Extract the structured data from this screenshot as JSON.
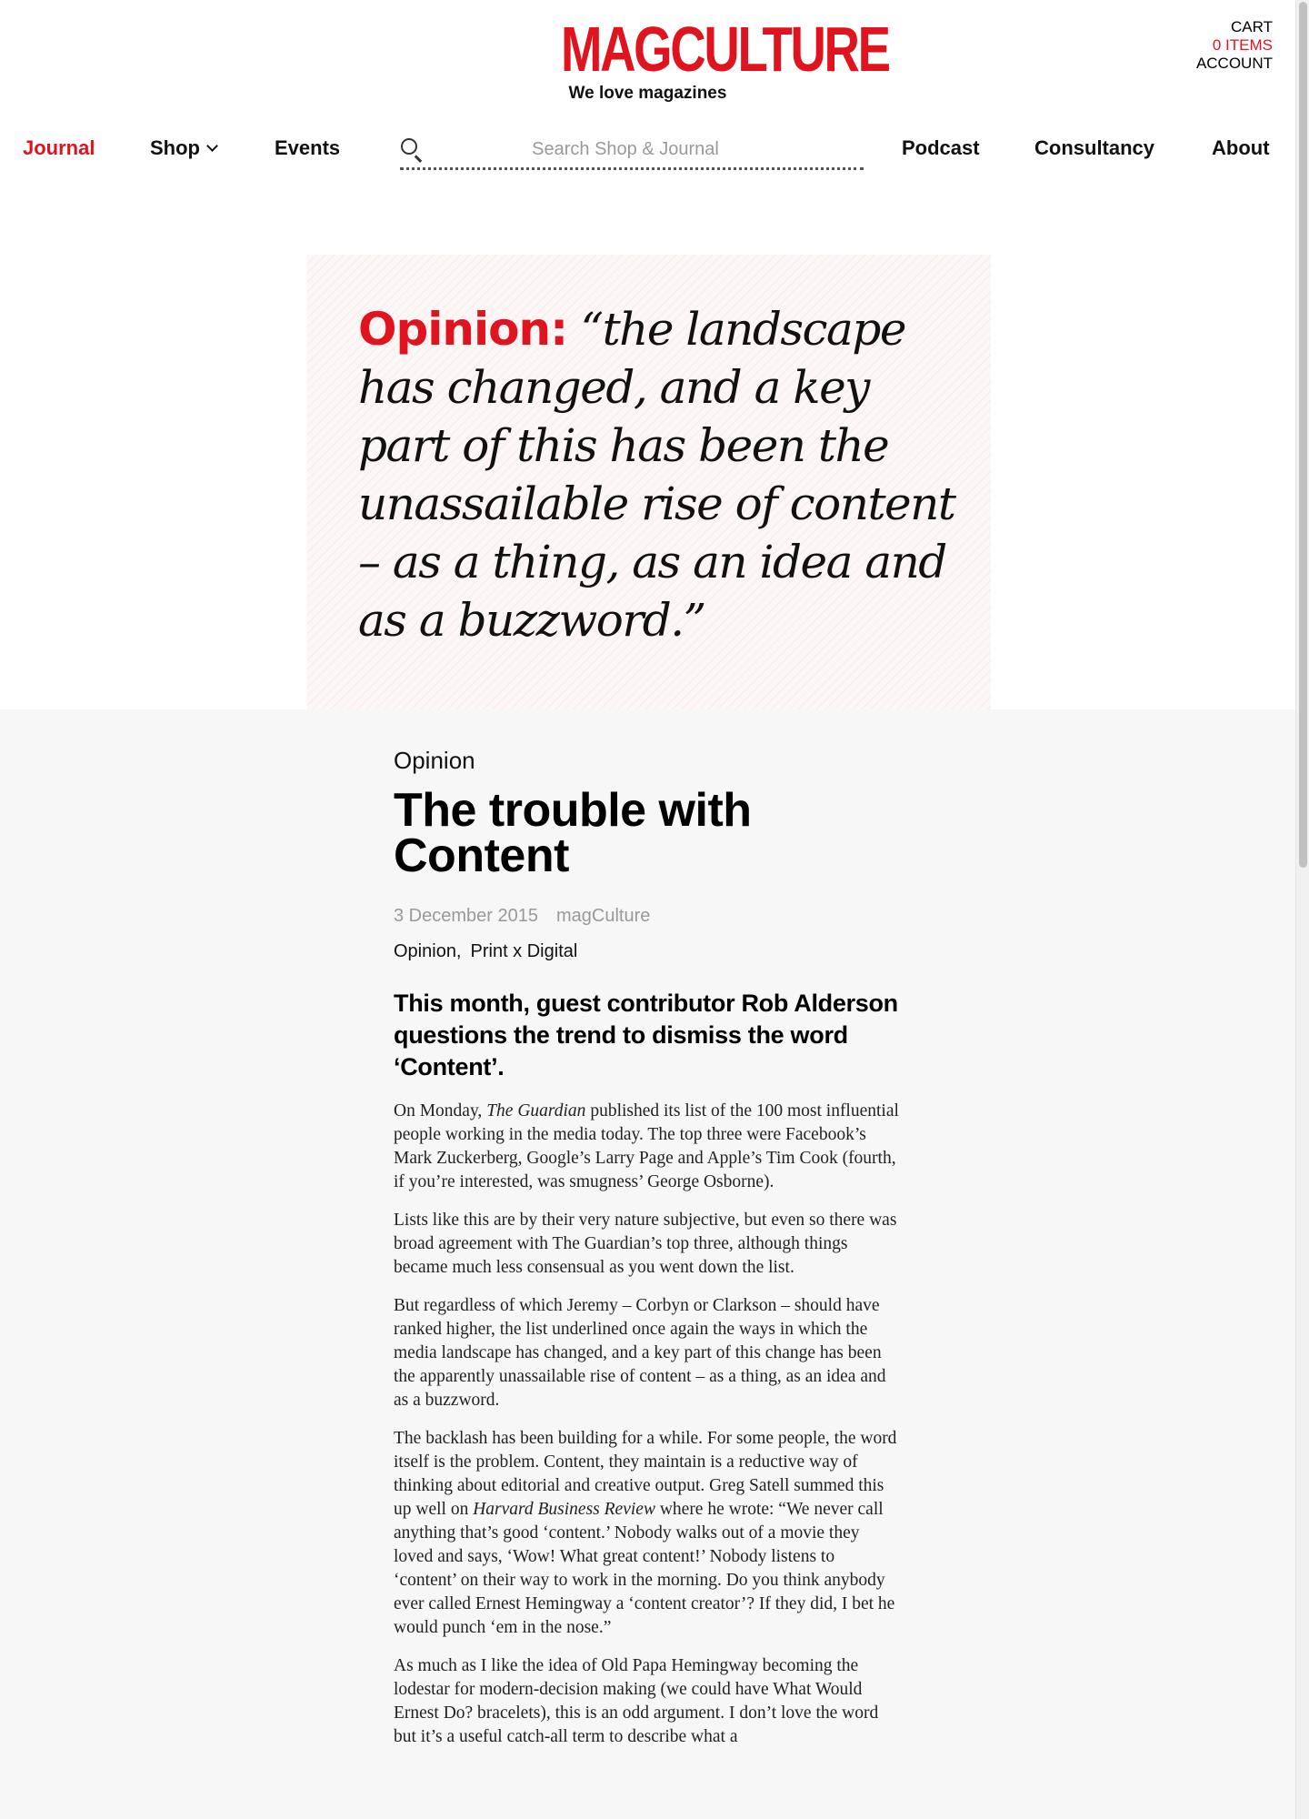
{
  "header": {
    "logo": "MAGCULTURE",
    "tagline": "We love magazines",
    "cart_label": "CART",
    "cart_items": "0 ITEMS",
    "account_label": "ACCOUNT"
  },
  "nav": {
    "journal": "Journal",
    "shop": "Shop",
    "events": "Events",
    "search_placeholder": "Search Shop & Journal",
    "podcast": "Podcast",
    "consultancy": "Consultancy",
    "about": "About"
  },
  "hero": {
    "label": "Opinion:",
    "quote": "“the landscape has changed, and a key part of this has been the unassailable rise of content – as a thing, as an idea and as a buzzword.”"
  },
  "article": {
    "category": "Opinion",
    "title": "The trouble with Content",
    "date": "3 December 2015",
    "author": "magCulture",
    "tags": [
      "Opinion,",
      "Print x Digital"
    ],
    "standfirst": "This month, guest contributor Rob Alderson questions the trend to dismiss the word ‘Content’.",
    "p1_a": "On Monday, ",
    "p1_em": "The Guardian",
    "p1_b": " published its list of the 100 most influential people working in the media today. The top three were Facebook’s Mark Zuckerberg, Google’s Larry Page and Apple’s Tim Cook (fourth, if you’re interested, was smugness’ George Osborne).",
    "p2": "Lists like this are by their very nature subjective, but even so there was broad agreement with The Guardian’s top three, although things became much less consensual as you went down the list.",
    "p3": "But regardless of which Jeremy – Corbyn or Clarkson – should have ranked higher, the list underlined once again the ways in which the media landscape has changed, and a key part of this change has been the apparently unassailable rise of content – as a thing, as an idea and as a buzzword.",
    "p4_a": "The backlash has been building for a while. For some people, the word itself is the problem. Content, they maintain is a reductive way of thinking about editorial and creative output. Greg Satell summed this up well on ",
    "p4_em": "Harvard Business Review",
    "p4_b": " where he wrote: “We never call anything that’s good ‘content.’ Nobody walks out of a movie they loved and says, ‘Wow! What great content!’ Nobody listens to ‘content’ on their way to work in the morning. Do you think anybody ever called Ernest Hemingway a ‘content creator’? If they did, I bet he would punch ‘em in the nose.”",
    "p5": "As much as I like the idea of Old Papa Hemingway becoming the lodestar for modern-decision making (we could have What Would Ernest Do? bracelets), this is an odd argument. I don’t love the word but it’s a useful catch-all term to describe what a"
  },
  "colors": {
    "brand_red": "#e0141e",
    "meta_grey": "#999999"
  }
}
